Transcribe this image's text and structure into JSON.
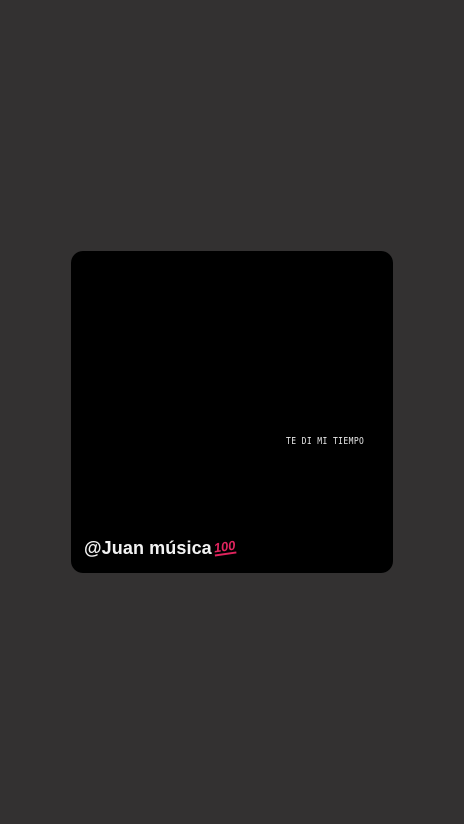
{
  "story": {
    "track_title": "TE DI MI TIEMPO",
    "username": "@Juan música",
    "emoji": {
      "icon": "hundred-points-icon",
      "text": "100"
    }
  },
  "colors": {
    "background": "#333131",
    "card": "#000000",
    "username_text": "#f2f2f2",
    "emoji": "#e0245e"
  }
}
